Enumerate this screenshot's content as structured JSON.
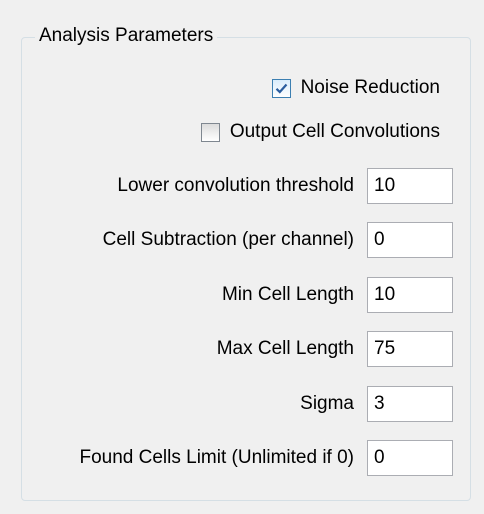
{
  "group": {
    "title": "Analysis Parameters"
  },
  "checkboxes": [
    {
      "label": "Noise Reduction",
      "checked": true
    },
    {
      "label": "Output Cell Convolutions",
      "checked": false
    }
  ],
  "fields": [
    {
      "label": "Lower convolution threshold",
      "value": "10"
    },
    {
      "label": "Cell Subtraction (per channel)",
      "value": "0"
    },
    {
      "label": "Min Cell Length",
      "value": "10"
    },
    {
      "label": "Max Cell Length",
      "value": "75"
    },
    {
      "label": "Sigma",
      "value": "3"
    },
    {
      "label": "Found Cells Limit (Unlimited if 0)",
      "value": "0"
    }
  ]
}
